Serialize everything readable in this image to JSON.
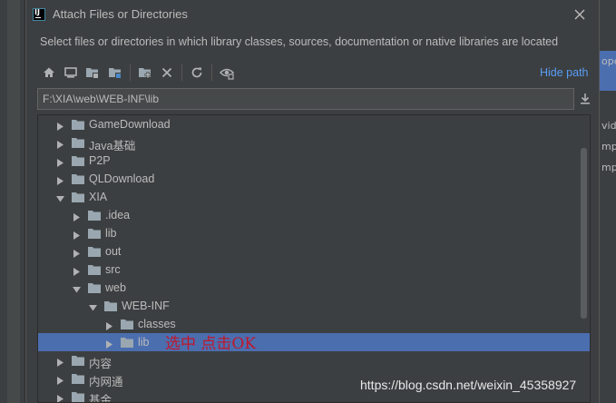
{
  "dialog": {
    "title": "Attach Files or Directories",
    "description": "Select files or directories in which library classes, sources, documentation or native libraries are located"
  },
  "toolbar": {
    "buttons": [
      {
        "icon": "home-icon"
      },
      {
        "icon": "desktop-icon"
      },
      {
        "icon": "project-folder-icon"
      },
      {
        "icon": "module-folder-icon"
      },
      {
        "icon": "new-folder-icon"
      },
      {
        "icon": "delete-icon"
      },
      {
        "icon": "refresh-icon"
      },
      {
        "icon": "show-hidden-icon"
      }
    ],
    "hide_path_label": "Hide path"
  },
  "path": {
    "value": "F:\\XIA\\web\\WEB-INF\\lib"
  },
  "tree": {
    "items": [
      {
        "label": "GameDownload",
        "level": 0,
        "expanded": false,
        "selected": false
      },
      {
        "label": "Java基础",
        "level": 0,
        "expanded": false,
        "selected": false
      },
      {
        "label": "P2P",
        "level": 0,
        "expanded": false,
        "selected": false
      },
      {
        "label": "QLDownload",
        "level": 0,
        "expanded": false,
        "selected": false
      },
      {
        "label": "XIA",
        "level": 0,
        "expanded": true,
        "selected": false
      },
      {
        "label": ".idea",
        "level": 1,
        "expanded": false,
        "selected": false
      },
      {
        "label": "lib",
        "level": 1,
        "expanded": false,
        "selected": false
      },
      {
        "label": "out",
        "level": 1,
        "expanded": false,
        "selected": false
      },
      {
        "label": "src",
        "level": 1,
        "expanded": false,
        "selected": false
      },
      {
        "label": "web",
        "level": 1,
        "expanded": true,
        "selected": false
      },
      {
        "label": "WEB-INF",
        "level": 2,
        "expanded": true,
        "selected": false
      },
      {
        "label": "classes",
        "level": 3,
        "expanded": false,
        "selected": false
      },
      {
        "label": "lib",
        "level": 3,
        "expanded": false,
        "selected": true
      },
      {
        "label": "内容",
        "level": 0,
        "expanded": false,
        "selected": false
      },
      {
        "label": "内网通",
        "level": 0,
        "expanded": false,
        "selected": false
      },
      {
        "label": "基金",
        "level": 0,
        "expanded": false,
        "selected": false
      }
    ]
  },
  "annotation": {
    "text": "选中  点击OK"
  },
  "background_ide": {
    "right_fragments": [
      "ope",
      "vid",
      "mp",
      "mp"
    ]
  },
  "watermark": {
    "text": "https://blog.csdn.net/weixin_45358927"
  },
  "colors": {
    "dialog_bg": "#3c3f41",
    "selection": "#4b6eaf",
    "link": "#589df6",
    "annotation": "#c0172c",
    "text": "#bbbbbb",
    "folder": "#9aa7b0"
  }
}
